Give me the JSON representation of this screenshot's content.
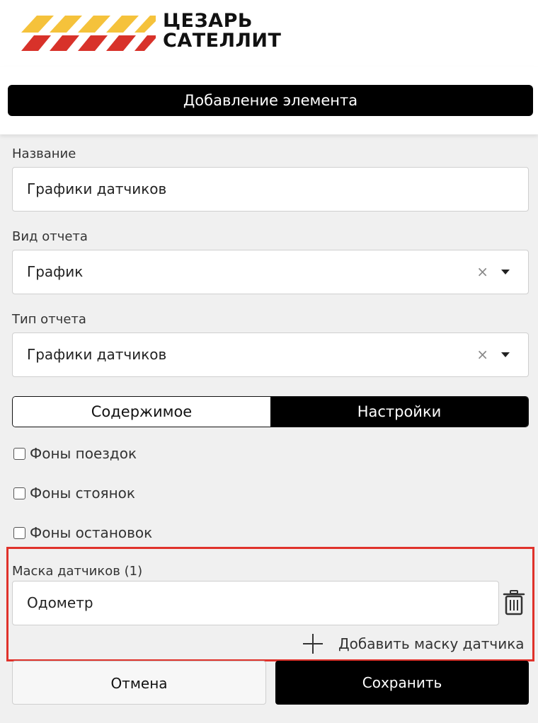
{
  "header": {
    "logo_line1": "ЦЕЗАРЬ",
    "logo_line2": "САТЕЛЛИТ",
    "brand_colors": {
      "yellow": "#f5c23b",
      "red": "#d8322a"
    }
  },
  "title": "Добавление элемента",
  "form": {
    "name": {
      "label": "Название",
      "value": "Графики датчиков"
    },
    "report_view": {
      "label": "Вид отчета",
      "value": "График",
      "clear_icon": "×"
    },
    "report_type": {
      "label": "Тип отчета",
      "value": "Графики датчиков",
      "clear_icon": "×"
    }
  },
  "tabs": [
    {
      "label": "Содержимое",
      "active": false
    },
    {
      "label": "Настройки",
      "active": true
    }
  ],
  "checkboxes": [
    {
      "label": "Фоны поездок",
      "checked": false
    },
    {
      "label": "Фоны стоянок",
      "checked": false
    },
    {
      "label": "Фоны остановок",
      "checked": false
    }
  ],
  "sensor_mask": {
    "label": "Маска датчиков (1)",
    "items": [
      {
        "value": "Одометр"
      }
    ],
    "add_label": "Добавить маску датчика",
    "highlight_color": "#e0322b"
  },
  "buttons": {
    "cancel": "Отмена",
    "save": "Сохранить"
  }
}
